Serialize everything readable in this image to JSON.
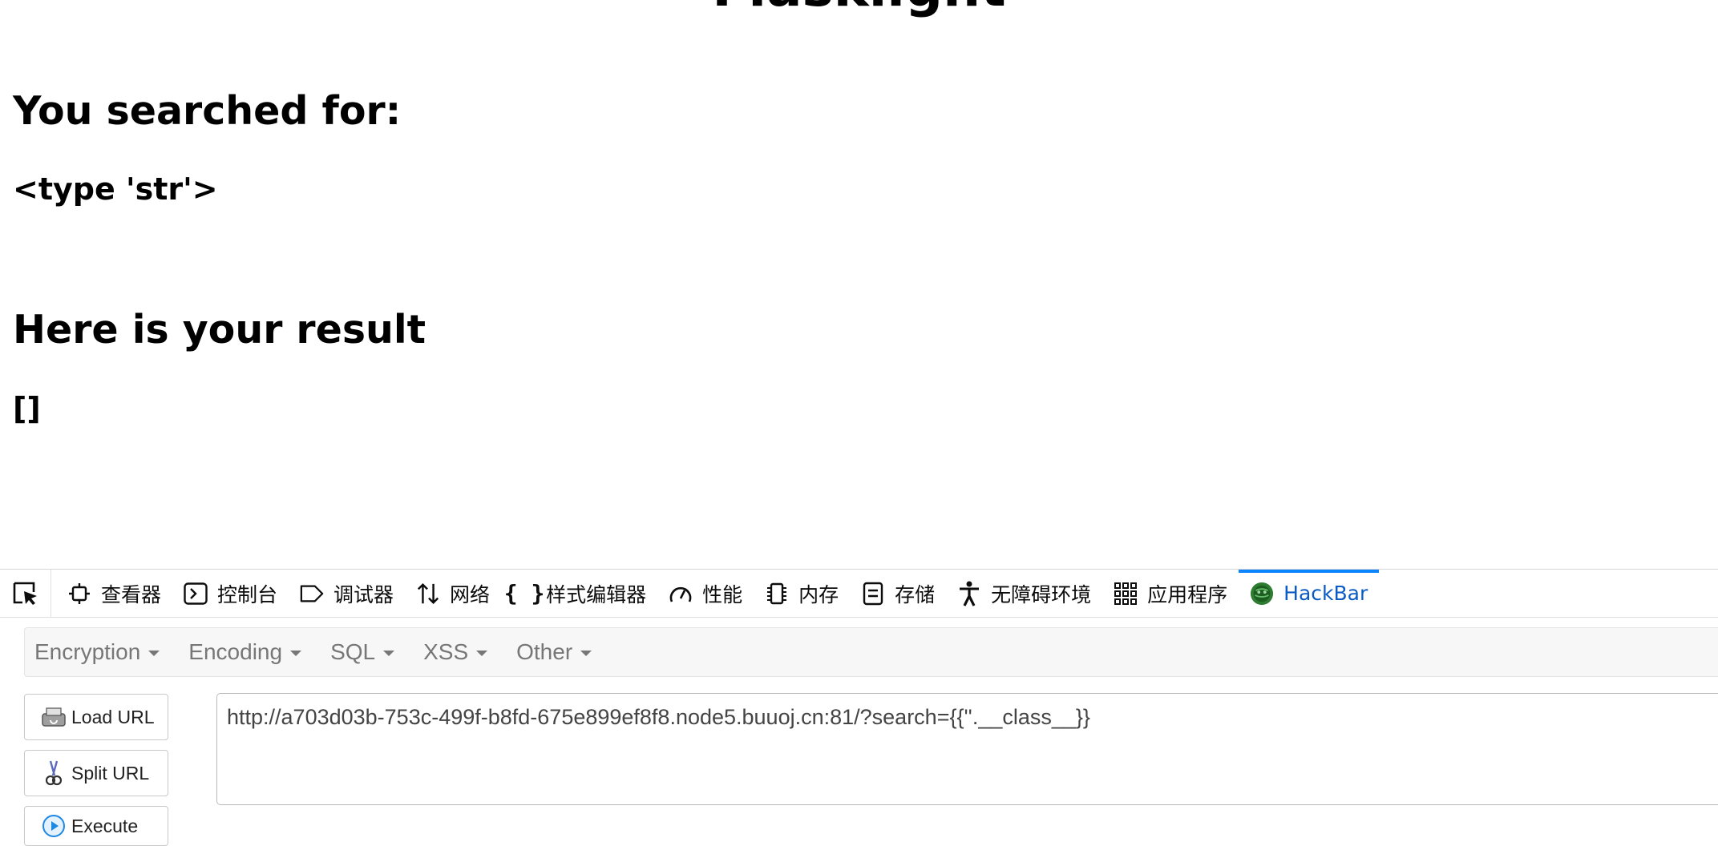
{
  "page": {
    "title": "Flasklight",
    "searched_heading": "You searched for:",
    "searched_value": "<type 'str'>",
    "result_heading": "Here is your result",
    "result_value": "[]"
  },
  "devtools": {
    "tabs": [
      {
        "label": "查看器",
        "icon": "inspector-icon"
      },
      {
        "label": "控制台",
        "icon": "console-icon"
      },
      {
        "label": "调试器",
        "icon": "debugger-icon"
      },
      {
        "label": "网络",
        "icon": "network-icon"
      },
      {
        "label": "样式编辑器",
        "icon": "style-editor-icon"
      },
      {
        "label": "性能",
        "icon": "performance-icon"
      },
      {
        "label": "内存",
        "icon": "memory-icon"
      },
      {
        "label": "存储",
        "icon": "storage-icon"
      },
      {
        "label": "无障碍环境",
        "icon": "accessibility-icon"
      },
      {
        "label": "应用程序",
        "icon": "application-icon"
      },
      {
        "label": "HackBar",
        "icon": "hackbar-icon"
      }
    ],
    "active_tab": "HackBar",
    "accent_color": "#0a84ff"
  },
  "hackbar": {
    "menus": [
      "Encryption",
      "Encoding",
      "SQL",
      "XSS",
      "Other"
    ],
    "buttons": {
      "load_url": "Load URL",
      "split_url": "Split URL",
      "execute": "Execute"
    },
    "url": "http://a703d03b-753c-499f-b8fd-675e899ef8f8.node5.buuoj.cn:81/?search={{''.__class__}}"
  }
}
